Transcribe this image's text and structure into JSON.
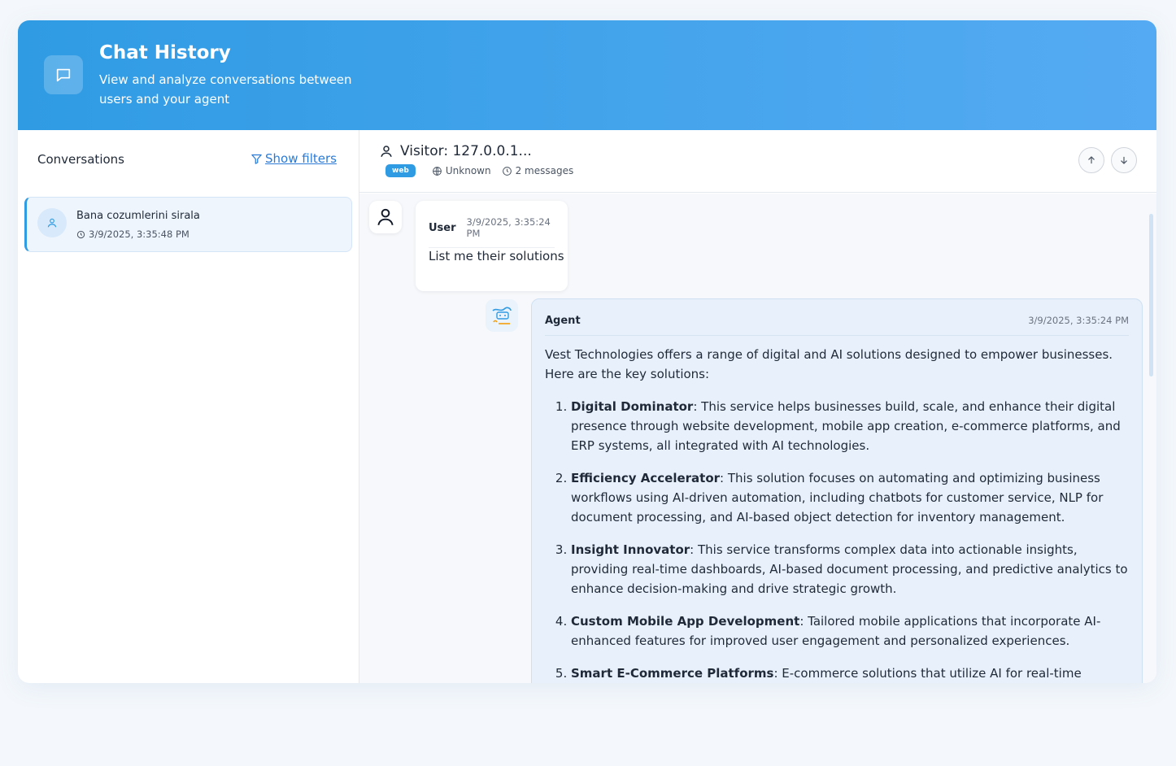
{
  "header": {
    "title": "Chat History",
    "subtitle": "View and analyze conversations between users and your agent"
  },
  "sidebar": {
    "title": "Conversations",
    "filters_label": "Show filters",
    "conversations": [
      {
        "title": "Bana cozumlerini sirala",
        "time": "3/9/2025, 3:35:48 PM"
      }
    ]
  },
  "conversation": {
    "visitor": "Visitor: 127.0.0.1...",
    "channel_badge": "web",
    "location": "Unknown",
    "message_count": "2 messages"
  },
  "messages": {
    "user": {
      "role": "User",
      "time": "3/9/2025, 3:35:24 PM",
      "text": "List me their solutions"
    },
    "agent": {
      "role": "Agent",
      "time": "3/9/2025, 3:35:24 PM",
      "intro": "Vest Technologies offers a range of digital and AI solutions designed to empower businesses. Here are the key solutions:",
      "items": [
        {
          "name": "Digital Dominator",
          "desc": ": This service helps businesses build, scale, and enhance their digital presence through website development, mobile app creation, e-commerce platforms, and ERP systems, all integrated with AI technologies."
        },
        {
          "name": "Efficiency Accelerator",
          "desc": ": This solution focuses on automating and optimizing business workflows using AI-driven automation, including chatbots for customer service, NLP for document processing, and AI-based object detection for inventory management."
        },
        {
          "name": "Insight Innovator",
          "desc": ": This service transforms complex data into actionable insights, providing real-time dashboards, AI-based document processing, and predictive analytics to enhance decision-making and drive strategic growth."
        },
        {
          "name": "Custom Mobile App Development",
          "desc": ": Tailored mobile applications that incorporate AI-enhanced features for improved user engagement and personalized experiences."
        },
        {
          "name": "Smart E-Commerce Platforms",
          "desc": ": E-commerce solutions that utilize AI for real-time analytics,"
        }
      ]
    }
  },
  "colors": {
    "header_gradient_start": "#2f9be3",
    "header_gradient_end": "#55abf3",
    "accent": "#2f9be3",
    "link": "#2b7bd6",
    "agent_bubble": "#e8f1fb"
  }
}
